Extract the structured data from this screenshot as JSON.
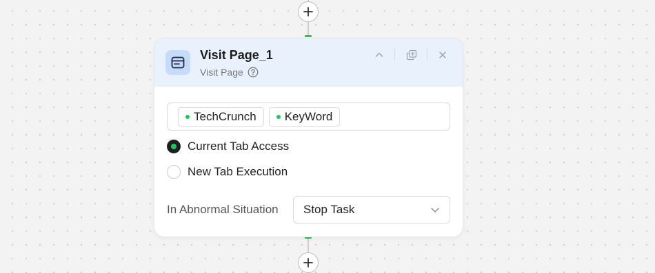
{
  "node": {
    "title": "Visit Page_1",
    "subtitle": "Visit Page",
    "icon": "browser-window-icon",
    "accent_color": "#22c55e",
    "header_bg": "#e9f1fd",
    "actions": [
      "collapse-icon",
      "duplicate-icon",
      "close-icon"
    ]
  },
  "tags": [
    {
      "label": "TechCrunch"
    },
    {
      "label": "KeyWord"
    }
  ],
  "tab_options": [
    {
      "label": "Current Tab Access",
      "selected": true
    },
    {
      "label": "New Tab Execution",
      "selected": false
    }
  ],
  "abnormal": {
    "label": "In Abnormal Situation",
    "value": "Stop Task"
  }
}
